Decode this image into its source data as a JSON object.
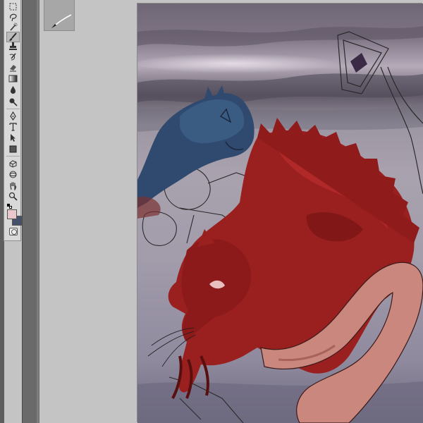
{
  "app": {
    "name": "image-editor"
  },
  "tools": [
    {
      "name": "marquee-tool",
      "icon": "marquee-icon"
    },
    {
      "name": "lasso-tool",
      "icon": "lasso-icon"
    },
    {
      "name": "quick-selection-tool",
      "icon": "quick-selection-icon"
    },
    {
      "name": "crop-tool",
      "icon": "crop-icon"
    },
    {
      "name": "eyedropper-tool",
      "icon": "eyedropper-icon"
    },
    {
      "name": "healing-brush-tool",
      "icon": "healing-icon"
    },
    {
      "name": "brush-tool",
      "icon": "brush-icon",
      "active": true
    },
    {
      "name": "clone-stamp-tool",
      "icon": "stamp-icon"
    },
    {
      "name": "history-brush-tool",
      "icon": "history-brush-icon"
    },
    {
      "name": "eraser-tool",
      "icon": "eraser-icon"
    },
    {
      "name": "gradient-tool",
      "icon": "gradient-icon"
    },
    {
      "name": "blur-tool",
      "icon": "blur-icon"
    },
    {
      "name": "dodge-tool",
      "icon": "dodge-icon"
    },
    {
      "name": "pen-tool",
      "icon": "pen-icon"
    },
    {
      "name": "type-tool",
      "icon": "type-icon"
    },
    {
      "name": "path-selection-tool",
      "icon": "path-selection-icon"
    },
    {
      "name": "rectangle-tool",
      "icon": "rectangle-icon"
    },
    {
      "name": "3d-rotate-tool",
      "icon": "3d-rotate-icon"
    },
    {
      "name": "3d-camera-tool",
      "icon": "3d-camera-icon"
    },
    {
      "name": "hand-tool",
      "icon": "hand-icon"
    },
    {
      "name": "zoom-tool",
      "icon": "zoom-icon"
    }
  ],
  "colors": {
    "foreground": "#e8c8cc",
    "background": "#45506a",
    "panel": "#d9d9d9",
    "workspace": "#c4c4c4"
  },
  "brush_preset": {
    "icon": "brush-stroke-icon"
  },
  "canvas": {
    "content": "painting-red-rat-blue-rat",
    "sky_top": "#6e6476",
    "fog": "#a8a1ac",
    "ground": "#7c788a",
    "rat_red": "#9c1e1e",
    "rat_blue": "#2f4a6e",
    "tail": "#c9877d"
  }
}
